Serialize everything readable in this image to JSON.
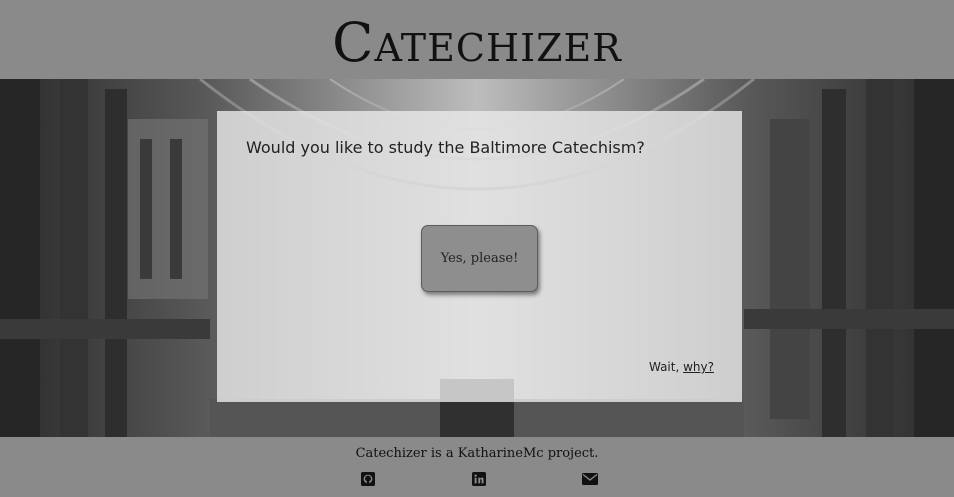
{
  "header": {
    "title": "Catechizer"
  },
  "card": {
    "question": "Would you like to study the Baltimore Catechism?",
    "yes_button": "Yes, please!",
    "wait_prefix": "Wait, ",
    "why_link": "why?"
  },
  "footer": {
    "credit": "Catechizer is a KatharineMc project.",
    "icons": [
      "github-icon",
      "linkedin-icon",
      "envelope-icon"
    ]
  }
}
